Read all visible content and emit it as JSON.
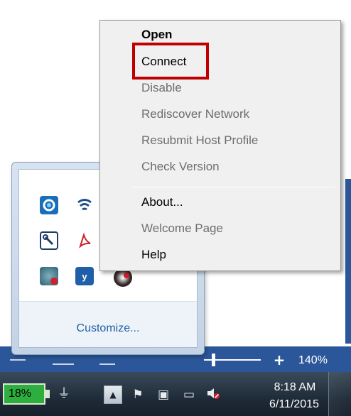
{
  "context_menu": {
    "items": [
      {
        "label": "Open",
        "enabled": true,
        "bold": true
      },
      {
        "label": "Connect",
        "enabled": true,
        "bold": false
      },
      {
        "label": "Disable",
        "enabled": false,
        "bold": false
      },
      {
        "label": "Rediscover Network",
        "enabled": false,
        "bold": false
      },
      {
        "label": "Resubmit Host Profile",
        "enabled": false,
        "bold": false
      },
      {
        "label": "Check Version",
        "enabled": false,
        "bold": false
      },
      {
        "label": "About...",
        "enabled": true,
        "bold": false
      },
      {
        "label": "Welcome Page",
        "enabled": false,
        "bold": false
      },
      {
        "label": "Help",
        "enabled": true,
        "bold": false
      }
    ],
    "highlight_color": "#c00000"
  },
  "tray_overflow": {
    "customize_label": "Customize...",
    "icons": [
      "sync-icon",
      "wifi-signal-icon",
      "wrench-icon",
      "adobe-pdf-icon",
      "disk-drive-icon",
      "yammer-icon",
      "antivirus-icon"
    ]
  },
  "status_bar": {
    "zoom_plus": "+",
    "zoom_level": "140%"
  },
  "taskbar": {
    "battery_percent": "18%",
    "clock_time": "8:18 AM",
    "clock_date": "6/11/2015",
    "tray_up_arrow": "▲"
  },
  "colors": {
    "accent_blue": "#2b579a",
    "battery_green": "#2fae40",
    "link_blue": "#1e5fa8"
  }
}
